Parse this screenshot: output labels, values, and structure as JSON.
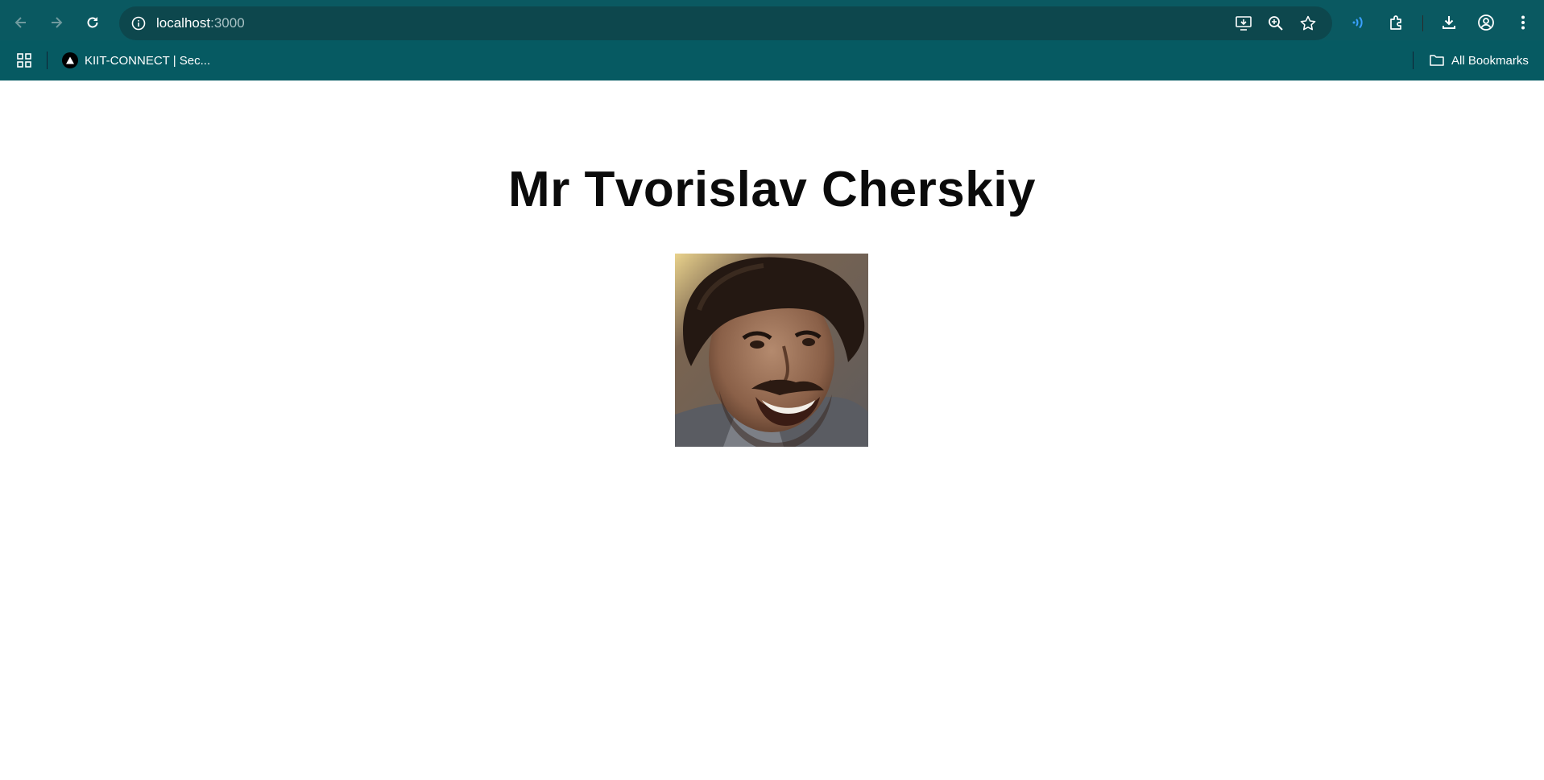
{
  "browser": {
    "url_host": "localhost",
    "url_port": ":3000",
    "bookmarks": [
      {
        "label": "KIIT-CONNECT | Sec..."
      }
    ],
    "all_bookmarks_label": "All Bookmarks",
    "colors": {
      "toolbar": "#0a5961",
      "omnibox": "#0d474d",
      "accent_icon": "#3aa0ff"
    }
  },
  "page": {
    "title": "Mr Tvorislav Cherskiy",
    "avatar_alt": "profile photo"
  }
}
